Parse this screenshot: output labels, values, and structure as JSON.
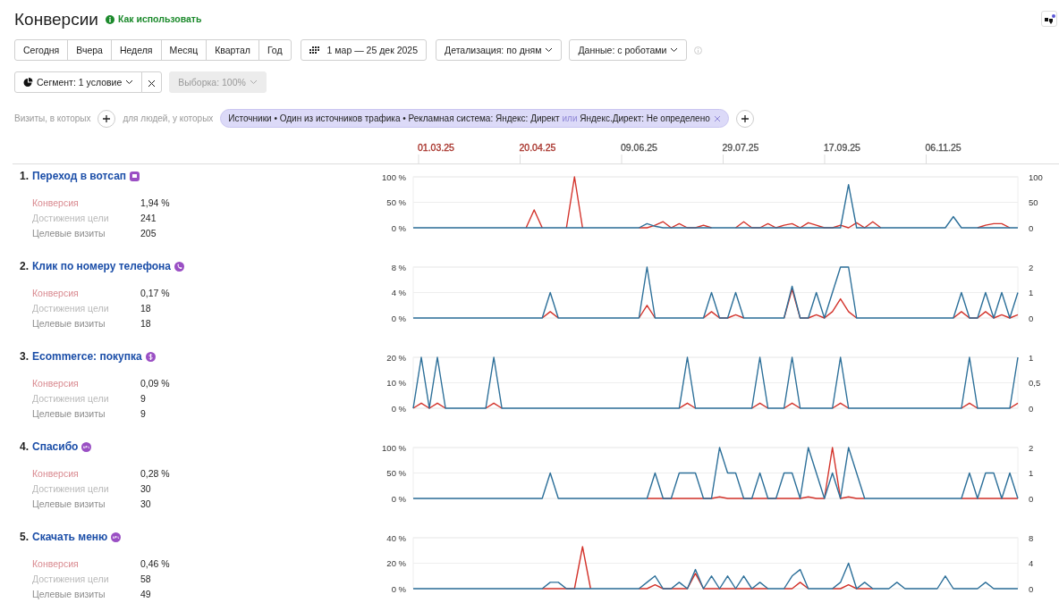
{
  "title": "Конверсии",
  "help_link": "Как использовать",
  "periods": [
    {
      "label": "Сегодня",
      "selected": false
    },
    {
      "label": "Вчера",
      "selected": false
    },
    {
      "label": "Неделя",
      "selected": false
    },
    {
      "label": "Месяц",
      "selected": false
    },
    {
      "label": "Квартал",
      "selected": false
    },
    {
      "label": "Год",
      "selected": false
    }
  ],
  "date_range": "1 мар — 25 дек 2025",
  "detail_dropdown": "Детализация: по дням",
  "data_dropdown": "Данные: с роботами",
  "segment_dropdown": "Сегмент: 1 условие",
  "sample_dropdown": {
    "label": "Выборка: 100%",
    "disabled": true
  },
  "filter": {
    "visits_label": "Визиты, в которых",
    "people_label": "для людей, у которых",
    "condition": "Источники • Один из источников трафика • Рекламная система: Яндекс: Директ",
    "connector": "или",
    "condition_2": "Яндекс.Директ: Не определено"
  },
  "timeline": [
    {
      "label": "01.03.25",
      "color": "#a8342c"
    },
    {
      "label": "20.04.25",
      "color": "#a8342c"
    },
    {
      "label": "09.06.25",
      "color": "#555555"
    },
    {
      "label": "29.07.25",
      "color": "#555555"
    },
    {
      "label": "17.09.25",
      "color": "#555555"
    },
    {
      "label": "06.11.25",
      "color": "#555555"
    }
  ],
  "goals": [
    {
      "number": "1.",
      "title": "Переход в вотсап",
      "kind": "message",
      "metrics": [
        {
          "kind": "conversion",
          "label": "Конверсия",
          "value": "1,94 %"
        },
        {
          "kind": "reaches",
          "label": "Достижения цели",
          "value": "241"
        },
        {
          "kind": "visits",
          "label": "Целевые визиты",
          "value": "205"
        }
      ],
      "right_axis": [
        "100",
        "50",
        "0"
      ],
      "chart_data": {
        "type": "line",
        "ylim": [
          0,
          100
        ],
        "yticks": [
          {
            "value": 0,
            "label": "0 %"
          },
          {
            "value": 50,
            "label": "50 %"
          },
          {
            "value": 100,
            "label": "100 %"
          }
        ],
        "series": [
          {
            "color": "#d3332b",
            "values": [
              null,
              null,
              null,
              null,
              null,
              null,
              null,
              null,
              null,
              null,
              null,
              null,
              null,
              null,
              0,
              35,
              0,
              null,
              null,
              0,
              100,
              0,
              null,
              null,
              null,
              null,
              null,
              null,
              0,
              0,
              5,
              12,
              0,
              8,
              0,
              0,
              5,
              0,
              null,
              null,
              0,
              12,
              0,
              0,
              8,
              0,
              5,
              8,
              0,
              10,
              5,
              0,
              0,
              5,
              0,
              10,
              0,
              12,
              0,
              null,
              null,
              null,
              null,
              null,
              null,
              null,
              null,
              null,
              null,
              null,
              0,
              5,
              8,
              8,
              0,
              null
            ]
          },
          {
            "color": "#2c6f99",
            "values": [
              0,
              0,
              0,
              0,
              0,
              0,
              0,
              0,
              0,
              0,
              0,
              0,
              0,
              0,
              0,
              0,
              0,
              0,
              0,
              0,
              0,
              0,
              0,
              0,
              0,
              0,
              0,
              0,
              0,
              8,
              3,
              0,
              0,
              0,
              0,
              0,
              0,
              0,
              0,
              0,
              0,
              0,
              0,
              0,
              0,
              0,
              0,
              0,
              0,
              0,
              0,
              0,
              0,
              0,
              85,
              0,
              0,
              0,
              0,
              0,
              0,
              0,
              0,
              0,
              0,
              0,
              0,
              22,
              0,
              0,
              0,
              0,
              0,
              0,
              0,
              0
            ]
          }
        ]
      }
    },
    {
      "number": "2.",
      "title": "Клик по номеру телефона",
      "kind": "phone",
      "metrics": [
        {
          "kind": "conversion",
          "label": "Конверсия",
          "value": "0,17 %"
        },
        {
          "kind": "reaches",
          "label": "Достижения цели",
          "value": "18"
        },
        {
          "kind": "visits",
          "label": "Целевые визиты",
          "value": "18"
        }
      ],
      "right_axis": [
        "2",
        "1",
        "0"
      ],
      "chart_data": {
        "type": "line",
        "ylim": [
          0,
          8
        ],
        "yticks": [
          {
            "value": 0,
            "label": "0 %"
          },
          {
            "value": 4,
            "label": "4 %"
          },
          {
            "value": 8,
            "label": "8 %"
          }
        ],
        "series": [
          {
            "color": "#d3332b",
            "values": [
              null,
              null,
              null,
              null,
              null,
              null,
              null,
              null,
              null,
              null,
              null,
              null,
              null,
              null,
              null,
              null,
              0,
              1,
              0,
              null,
              null,
              null,
              null,
              null,
              null,
              null,
              null,
              null,
              0,
              2,
              0,
              null,
              null,
              null,
              null,
              null,
              0,
              1,
              0,
              0,
              0.5,
              0,
              null,
              null,
              null,
              null,
              0,
              4.5,
              0,
              0,
              0.5,
              0,
              1,
              3,
              1,
              0,
              null,
              null,
              null,
              null,
              null,
              null,
              null,
              null,
              null,
              null,
              null,
              0,
              1,
              0,
              0,
              1,
              0,
              0.5,
              0,
              0.5
            ]
          },
          {
            "color": "#2c6f99",
            "values": [
              0,
              0,
              0,
              0,
              0,
              0,
              0,
              0,
              0,
              0,
              0,
              0,
              0,
              0,
              0,
              0,
              0,
              4,
              0,
              0,
              0,
              0,
              0,
              0,
              0,
              0,
              0,
              0,
              0,
              8,
              0,
              0,
              0,
              0,
              0,
              0,
              0,
              4,
              0,
              0,
              4,
              0,
              0,
              0,
              0,
              0,
              0,
              5,
              0,
              0,
              4,
              0,
              4,
              8,
              8,
              0,
              0,
              0,
              0,
              0,
              0,
              0,
              0,
              0,
              0,
              0,
              0,
              0,
              4,
              0,
              0,
              4,
              0,
              4,
              0,
              4
            ]
          }
        ]
      }
    },
    {
      "number": "3.",
      "title": "Ecommerce: покупка",
      "kind": "ecommerce",
      "metrics": [
        {
          "kind": "conversion",
          "label": "Конверсия",
          "value": "0,09 %"
        },
        {
          "kind": "reaches",
          "label": "Достижения цели",
          "value": "9"
        },
        {
          "kind": "visits",
          "label": "Целевые визиты",
          "value": "9"
        }
      ],
      "right_axis": [
        "1",
        "0,5",
        "0"
      ],
      "chart_data": {
        "type": "line",
        "ylim": [
          0,
          20
        ],
        "yticks": [
          {
            "value": 0,
            "label": "0 %"
          },
          {
            "value": 10,
            "label": "10 %"
          },
          {
            "value": 20,
            "label": "20 %"
          }
        ],
        "series": [
          {
            "color": "#d3332b",
            "values": [
              0,
              2,
              0,
              2,
              0,
              null,
              null,
              null,
              null,
              0,
              2,
              0,
              null,
              null,
              null,
              null,
              null,
              null,
              null,
              null,
              null,
              null,
              null,
              null,
              null,
              null,
              null,
              null,
              null,
              null,
              null,
              null,
              null,
              0,
              2,
              0,
              null,
              null,
              null,
              null,
              null,
              null,
              0,
              2,
              0,
              null,
              0,
              2,
              0,
              null,
              null,
              null,
              0,
              2,
              0,
              null,
              null,
              null,
              null,
              null,
              null,
              null,
              null,
              null,
              null,
              null,
              null,
              null,
              0,
              2,
              0,
              null,
              null,
              null,
              0,
              2
            ]
          },
          {
            "color": "#2c6f99",
            "values": [
              0,
              20,
              0,
              20,
              0,
              0,
              0,
              0,
              0,
              0,
              20,
              0,
              0,
              0,
              0,
              0,
              0,
              0,
              0,
              0,
              0,
              0,
              0,
              0,
              0,
              0,
              0,
              0,
              0,
              0,
              0,
              0,
              0,
              0,
              20,
              0,
              0,
              0,
              0,
              0,
              0,
              0,
              0,
              20,
              0,
              0,
              0,
              20,
              0,
              0,
              0,
              0,
              0,
              20,
              0,
              0,
              0,
              0,
              0,
              0,
              0,
              0,
              0,
              0,
              0,
              0,
              0,
              0,
              0,
              20,
              0,
              0,
              0,
              0,
              0,
              20
            ]
          }
        ]
      }
    },
    {
      "number": "4.",
      "title": "Спасибо",
      "kind": "url",
      "metrics": [
        {
          "kind": "conversion",
          "label": "Конверсия",
          "value": "0,28 %"
        },
        {
          "kind": "reaches",
          "label": "Достижения цели",
          "value": "30"
        },
        {
          "kind": "visits",
          "label": "Целевые визиты",
          "value": "30"
        }
      ],
      "right_axis": [
        "2",
        "1",
        "0"
      ],
      "chart_data": {
        "type": "line",
        "ylim": [
          0,
          100
        ],
        "yticks": [
          {
            "value": 0,
            "label": "0 %"
          },
          {
            "value": 50,
            "label": "50 %"
          },
          {
            "value": 100,
            "label": "100 %"
          }
        ],
        "series": [
          {
            "color": "#d3332b",
            "values": [
              null,
              null,
              null,
              null,
              null,
              null,
              null,
              null,
              null,
              null,
              null,
              null,
              null,
              null,
              null,
              null,
              null,
              null,
              null,
              null,
              null,
              null,
              null,
              null,
              null,
              null,
              null,
              null,
              null,
              0,
              0,
              0,
              0,
              0,
              0,
              0,
              0,
              0,
              3,
              0,
              0,
              0,
              0,
              0,
              0,
              0,
              0,
              0,
              0,
              3,
              0,
              0,
              100,
              0,
              3,
              0,
              0,
              null,
              null,
              null,
              null,
              null,
              null,
              null,
              null,
              null,
              null,
              null,
              0,
              0,
              0,
              0,
              0,
              0,
              0,
              0
            ]
          },
          {
            "color": "#2c6f99",
            "values": [
              0,
              0,
              0,
              0,
              0,
              0,
              0,
              0,
              0,
              0,
              0,
              0,
              0,
              0,
              0,
              0,
              0,
              50,
              0,
              0,
              0,
              0,
              0,
              0,
              0,
              0,
              0,
              0,
              0,
              0,
              50,
              0,
              0,
              50,
              50,
              50,
              0,
              0,
              100,
              50,
              50,
              0,
              0,
              50,
              0,
              0,
              50,
              50,
              0,
              100,
              50,
              0,
              50,
              0,
              100,
              50,
              0,
              0,
              0,
              0,
              0,
              0,
              0,
              0,
              0,
              0,
              0,
              0,
              0,
              50,
              0,
              50,
              50,
              0,
              50,
              0
            ]
          }
        ]
      }
    },
    {
      "number": "5.",
      "title": "Скачать меню",
      "kind": "url",
      "metrics": [
        {
          "kind": "conversion",
          "label": "Конверсия",
          "value": "0,46 %"
        },
        {
          "kind": "reaches",
          "label": "Достижения цели",
          "value": "58"
        },
        {
          "kind": "visits",
          "label": "Целевые визиты",
          "value": "49"
        }
      ],
      "right_axis": [
        "8",
        "4",
        "0"
      ],
      "chart_data": {
        "type": "line",
        "ylim": [
          0,
          40
        ],
        "yticks": [
          {
            "value": 0,
            "label": "0 %"
          },
          {
            "value": 20,
            "label": "20 %"
          },
          {
            "value": 40,
            "label": "40 %"
          }
        ],
        "series": [
          {
            "color": "#d3332b",
            "values": [
              null,
              null,
              null,
              null,
              null,
              null,
              null,
              null,
              null,
              null,
              null,
              null,
              null,
              null,
              null,
              null,
              0,
              0,
              0,
              0,
              0,
              33,
              0,
              null,
              null,
              null,
              null,
              null,
              0,
              0,
              3,
              0,
              0,
              0,
              0,
              12,
              0,
              0,
              0,
              0,
              0,
              0,
              0,
              0,
              0,
              null,
              0,
              0,
              5,
              0,
              null,
              null,
              0,
              0,
              3,
              0,
              0,
              0,
              null,
              null,
              null,
              null,
              null,
              null,
              null,
              null,
              null,
              null,
              null,
              null,
              null,
              null,
              null,
              null,
              null,
              null
            ]
          },
          {
            "color": "#2c6f99",
            "values": [
              0,
              0,
              0,
              0,
              0,
              0,
              0,
              0,
              0,
              0,
              0,
              0,
              0,
              0,
              0,
              0,
              0,
              5,
              5,
              0,
              0,
              0,
              0,
              0,
              0,
              0,
              0,
              0,
              0,
              5,
              10,
              0,
              0,
              5,
              0,
              15,
              0,
              10,
              0,
              10,
              0,
              10,
              0,
              5,
              0,
              0,
              0,
              10,
              15,
              0,
              0,
              0,
              0,
              5,
              20,
              0,
              5,
              0,
              0,
              0,
              5,
              0,
              0,
              0,
              0,
              0,
              10,
              0,
              0,
              0,
              0,
              5,
              0,
              0,
              0,
              0
            ]
          }
        ]
      }
    }
  ]
}
